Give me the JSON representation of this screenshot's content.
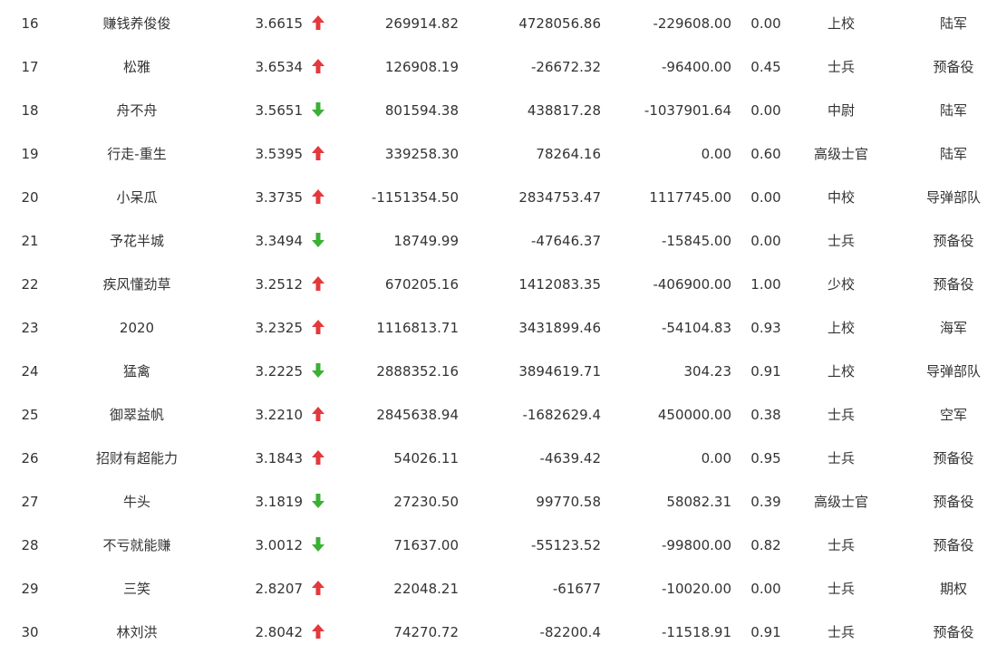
{
  "colors": {
    "up": "#e4393c",
    "down": "#3cb034",
    "text": "#333333"
  },
  "icons": {
    "up": "arrow-up-icon",
    "down": "arrow-down-icon"
  },
  "rows": [
    {
      "rank": "16",
      "name": "赚钱养俊俊",
      "score": "3.6615",
      "trend": "up",
      "v1": "269914.82",
      "v2": "4728056.86",
      "v3": "-229608.00",
      "ratio": "0.00",
      "rank_name": "上校",
      "branch": "陆军"
    },
    {
      "rank": "17",
      "name": "松雅",
      "score": "3.6534",
      "trend": "up",
      "v1": "126908.19",
      "v2": "-26672.32",
      "v3": "-96400.00",
      "ratio": "0.45",
      "rank_name": "士兵",
      "branch": "预备役"
    },
    {
      "rank": "18",
      "name": "舟不舟",
      "score": "3.5651",
      "trend": "down",
      "v1": "801594.38",
      "v2": "438817.28",
      "v3": "-1037901.64",
      "ratio": "0.00",
      "rank_name": "中尉",
      "branch": "陆军"
    },
    {
      "rank": "19",
      "name": "行走-重生",
      "score": "3.5395",
      "trend": "up",
      "v1": "339258.30",
      "v2": "78264.16",
      "v3": "0.00",
      "ratio": "0.60",
      "rank_name": "高级士官",
      "branch": "陆军"
    },
    {
      "rank": "20",
      "name": "小呆瓜",
      "score": "3.3735",
      "trend": "up",
      "v1": "-1151354.50",
      "v2": "2834753.47",
      "v3": "1117745.00",
      "ratio": "0.00",
      "rank_name": "中校",
      "branch": "导弹部队"
    },
    {
      "rank": "21",
      "name": "予花半城",
      "score": "3.3494",
      "trend": "down",
      "v1": "18749.99",
      "v2": "-47646.37",
      "v3": "-15845.00",
      "ratio": "0.00",
      "rank_name": "士兵",
      "branch": "预备役"
    },
    {
      "rank": "22",
      "name": "疾风懂劲草",
      "score": "3.2512",
      "trend": "up",
      "v1": "670205.16",
      "v2": "1412083.35",
      "v3": "-406900.00",
      "ratio": "1.00",
      "rank_name": "少校",
      "branch": "预备役"
    },
    {
      "rank": "23",
      "name": "2020",
      "score": "3.2325",
      "trend": "up",
      "v1": "1116813.71",
      "v2": "3431899.46",
      "v3": "-54104.83",
      "ratio": "0.93",
      "rank_name": "上校",
      "branch": "海军"
    },
    {
      "rank": "24",
      "name": "猛禽",
      "score": "3.2225",
      "trend": "down",
      "v1": "2888352.16",
      "v2": "3894619.71",
      "v3": "304.23",
      "ratio": "0.91",
      "rank_name": "上校",
      "branch": "导弹部队"
    },
    {
      "rank": "25",
      "name": "御翠益帆",
      "score": "3.2210",
      "trend": "up",
      "v1": "2845638.94",
      "v2": "-1682629.4",
      "v3": "450000.00",
      "ratio": "0.38",
      "rank_name": "士兵",
      "branch": "空军"
    },
    {
      "rank": "26",
      "name": "招财有超能力",
      "score": "3.1843",
      "trend": "up",
      "v1": "54026.11",
      "v2": "-4639.42",
      "v3": "0.00",
      "ratio": "0.95",
      "rank_name": "士兵",
      "branch": "预备役"
    },
    {
      "rank": "27",
      "name": "牛头",
      "score": "3.1819",
      "trend": "down",
      "v1": "27230.50",
      "v2": "99770.58",
      "v3": "58082.31",
      "ratio": "0.39",
      "rank_name": "高级士官",
      "branch": "预备役"
    },
    {
      "rank": "28",
      "name": "不亏就能赚",
      "score": "3.0012",
      "trend": "down",
      "v1": "71637.00",
      "v2": "-55123.52",
      "v3": "-99800.00",
      "ratio": "0.82",
      "rank_name": "士兵",
      "branch": "预备役"
    },
    {
      "rank": "29",
      "name": "三笑",
      "score": "2.8207",
      "trend": "up",
      "v1": "22048.21",
      "v2": "-61677",
      "v3": "-10020.00",
      "ratio": "0.00",
      "rank_name": "士兵",
      "branch": "期权"
    },
    {
      "rank": "30",
      "name": "林刘洪",
      "score": "2.8042",
      "trend": "up",
      "v1": "74270.72",
      "v2": "-82200.4",
      "v3": "-11518.91",
      "ratio": "0.91",
      "rank_name": "士兵",
      "branch": "预备役"
    }
  ]
}
